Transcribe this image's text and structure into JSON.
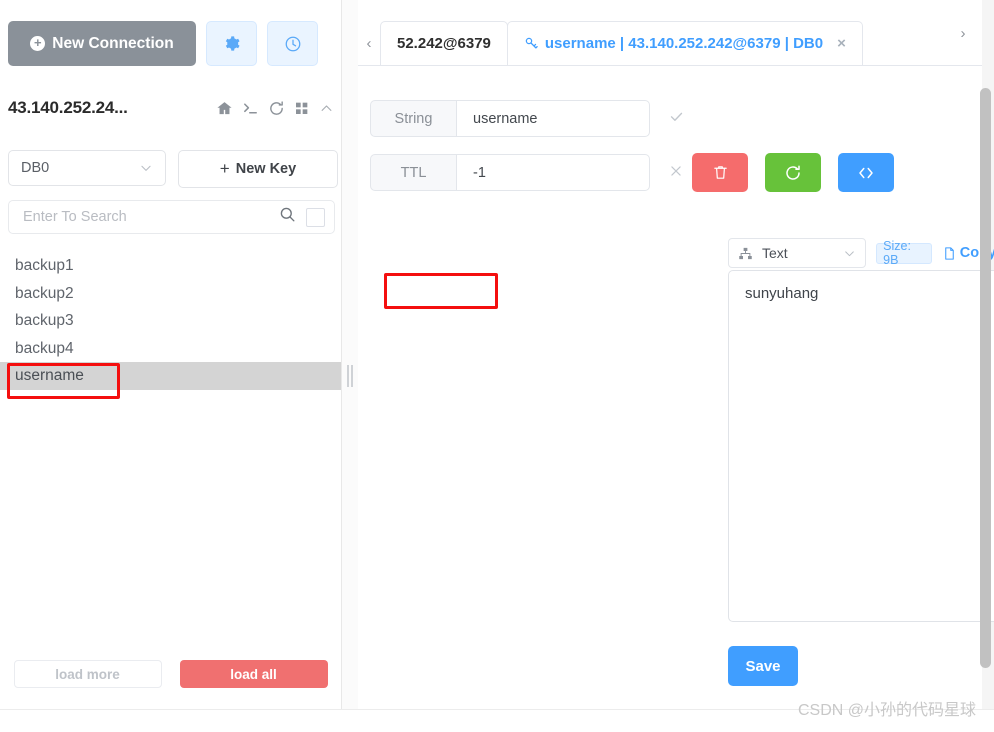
{
  "sidebar": {
    "new_connection_label": "New Connection",
    "icon_buttons": [
      {
        "name": "settings-icon-button",
        "icon": "gear-icon"
      },
      {
        "name": "history-icon-button",
        "icon": "clock-icon"
      }
    ],
    "host_name": "43.140.252.24...",
    "host_icons": [
      "home-icon",
      "terminal-icon",
      "refresh-icon",
      "grid-icon",
      "chevron-up-icon"
    ],
    "db_selected": "DB0",
    "new_key_label": "New Key",
    "search_placeholder": "Enter To Search",
    "search_value": "",
    "keys": [
      "backup1",
      "backup2",
      "backup3",
      "backup4",
      "username"
    ],
    "selected_key": "username",
    "load_more_label": "load more",
    "load_all_label": "load all"
  },
  "tabs": {
    "prev_arrow": "‹",
    "next_arrow": "›",
    "items": [
      {
        "label": "52.242@6379",
        "active": false
      },
      {
        "label": "username | 43.140.252.242@6379 | DB0",
        "active": true
      }
    ],
    "close_glyph": "×"
  },
  "editor": {
    "key_type": "String",
    "key_name": "username",
    "ttl_label": "TTL",
    "ttl_value": "-1",
    "actions": [
      {
        "name": "delete-key-button",
        "icon": "trash-icon",
        "color": "#f56c6c"
      },
      {
        "name": "reload-key-button",
        "icon": "refresh-icon",
        "color": "#67c23a"
      },
      {
        "name": "view-code-button",
        "icon": "code-icon",
        "color": "#409eff"
      }
    ],
    "view_format": "Text",
    "size_label": "Size: 9B",
    "copy_label": "Copy",
    "value": "sunyuhang",
    "save_label": "Save"
  },
  "watermark": "CSDN @小孙的代码星球",
  "colors": {
    "accent_blue": "#409eff",
    "danger_red": "#f56c6c",
    "success_green": "#67c23a",
    "annotation_red": "#f40f0f",
    "new_connection_grey": "#8a9199"
  }
}
